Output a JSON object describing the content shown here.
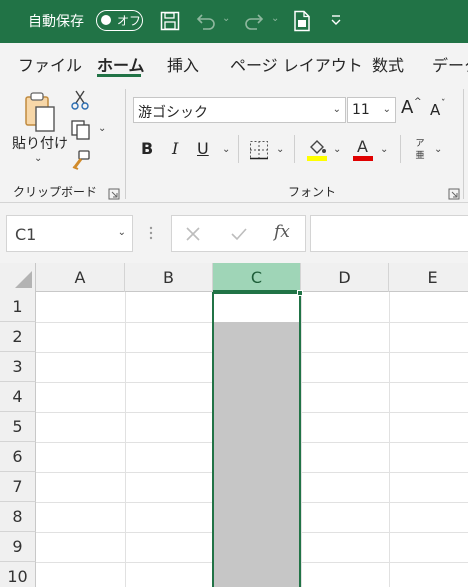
{
  "titlebar": {
    "autosave_label": "自動保存",
    "autosave_state": "オフ",
    "icons": [
      "save-icon",
      "undo-icon",
      "redo-icon",
      "document-icon",
      "customize-icon"
    ]
  },
  "tabs": [
    {
      "label": "ファイル",
      "active": false
    },
    {
      "label": "ホーム",
      "active": true
    },
    {
      "label": "挿入",
      "active": false
    },
    {
      "label": "ページ レイアウト",
      "active": false
    },
    {
      "label": "数式",
      "active": false
    },
    {
      "label": "データ",
      "active": false
    }
  ],
  "ribbon": {
    "clipboard": {
      "group_label": "クリップボード",
      "paste_label": "貼り付け"
    },
    "font": {
      "group_label": "フォント",
      "font_name": "游ゴシック",
      "font_size": "11",
      "bold": "B",
      "italic": "I",
      "underline": "U",
      "furigana": "ア\n亜"
    }
  },
  "formula_bar": {
    "name_box": "C1",
    "formula_value": ""
  },
  "grid": {
    "columns": [
      "A",
      "B",
      "C",
      "D",
      "E"
    ],
    "rows": [
      "1",
      "2",
      "3",
      "4",
      "5",
      "6",
      "7",
      "8",
      "9",
      "10"
    ],
    "selected_column": "C"
  },
  "colors": {
    "accent": "#217346",
    "selection_header": "#9fd5b7",
    "selection_fill": "#c6c6c6"
  }
}
